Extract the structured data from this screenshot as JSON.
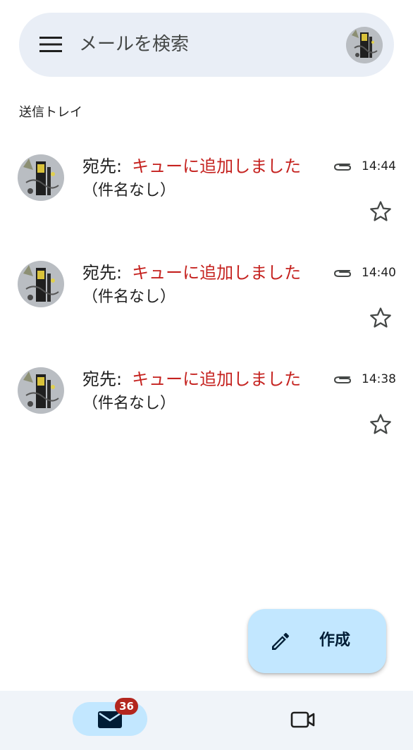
{
  "search": {
    "placeholder": "メールを検索"
  },
  "folder": {
    "label": "送信トレイ"
  },
  "mails": [
    {
      "to_label": "宛先:",
      "status": "キューに追加しました",
      "time": "14:44",
      "subject": "（件名なし）",
      "has_attachment": true,
      "starred": false
    },
    {
      "to_label": "宛先:",
      "status": "キューに追加しました",
      "time": "14:40",
      "subject": "（件名なし）",
      "has_attachment": true,
      "starred": false
    },
    {
      "to_label": "宛先:",
      "status": "キューに追加しました",
      "time": "14:38",
      "subject": "（件名なし）",
      "has_attachment": true,
      "starred": false
    }
  ],
  "compose": {
    "label": "作成"
  },
  "bottom_nav": {
    "mail_badge": "36"
  },
  "icons": {
    "menu": "menu-icon",
    "avatar": "avatar",
    "attachment": "paperclip-icon",
    "star": "star-outline-icon",
    "compose": "pencil-icon",
    "mail": "mail-icon",
    "meet": "video-camera-icon"
  },
  "colors": {
    "search_bar_bg": "#e9eef6",
    "status_red": "#c5221f",
    "fab_bg": "#c2e7ff",
    "nav_bg": "#f0f4f9",
    "badge_bg": "#b3261e"
  }
}
